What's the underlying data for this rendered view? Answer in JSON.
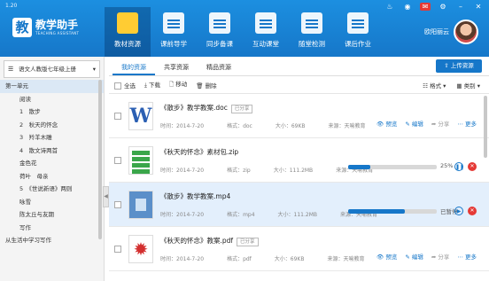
{
  "app": {
    "version": "1.20",
    "title": "教学助手",
    "subtitle": "TEACHING ASSISTANT",
    "user_name": "欧阳丽云"
  },
  "nav": [
    {
      "label": "教材资源",
      "icon": "folder-icon",
      "active": true
    },
    {
      "label": "课前导学",
      "icon": "document-icon",
      "active": false
    },
    {
      "label": "同步备课",
      "icon": "lesson-plan-icon",
      "active": false
    },
    {
      "label": "互动课堂",
      "icon": "classroom-screen-icon",
      "active": false
    },
    {
      "label": "随堂检测",
      "icon": "quiz-icon",
      "active": false
    },
    {
      "label": "课后作业",
      "icon": "homework-icon",
      "active": false
    }
  ],
  "sidebar": {
    "select": "语文人教版七年级上册",
    "items": [
      {
        "label": "第一单元",
        "level": 0
      },
      {
        "label": "阅读",
        "level": 1
      },
      {
        "label": "1　散步",
        "level": 1
      },
      {
        "label": "2　秋天的怀念",
        "level": 1
      },
      {
        "label": "3　羚羊木雕",
        "level": 1
      },
      {
        "label": "4　散文诗两首",
        "level": 1
      },
      {
        "label": "金色花",
        "level": 1
      },
      {
        "label": "荷叶　母亲",
        "level": 1
      },
      {
        "label": "5　《世说新语》两则",
        "level": 1
      },
      {
        "label": "咏雪",
        "level": 1
      },
      {
        "label": "陈太丘与友期",
        "level": 1
      },
      {
        "label": "写作",
        "level": 1
      },
      {
        "label": "从生活中学习写作",
        "level": 0
      }
    ]
  },
  "content": {
    "tabs": [
      {
        "label": "我的资源",
        "active": true
      },
      {
        "label": "共享资源",
        "active": false
      },
      {
        "label": "精品资源",
        "active": false
      }
    ],
    "upload_label": "上传资源",
    "toolbar": {
      "select_all": "全选",
      "download": "下载",
      "move": "移动",
      "delete": "删除",
      "format": "格式",
      "category": "类别"
    },
    "files": [
      {
        "name": "《散步》教学教案.doc",
        "type": "doc",
        "shared": "已分享",
        "time": "时间：2014-7-20",
        "format": "格式：doc",
        "size": "大小：69KB",
        "source": "来源：天喻教育",
        "mode": "actions"
      },
      {
        "name": "《秋天的怀念》素材包.zip",
        "type": "zip",
        "shared": "",
        "time": "时间：2014-7-20",
        "format": "格式：zip",
        "size": "大小：111.2MB",
        "source": "来源：天喻教育",
        "mode": "progress",
        "progress": 25,
        "progress_label": "25%"
      },
      {
        "name": "《散步》教学教案.mp4",
        "type": "mp4",
        "shared": "",
        "time": "时间：2014-7-20",
        "format": "格式：mp4",
        "size": "大小：111.2MB",
        "source": "来源：天喻教育",
        "mode": "progress",
        "progress": 64,
        "progress_label": "已暂停"
      },
      {
        "name": "《秋天的怀念》教案.pdf",
        "type": "pdf",
        "shared": "已分享",
        "time": "时间：2014-7-20",
        "format": "格式：pdf",
        "size": "大小：69KB",
        "source": "来源：天喻教育",
        "mode": "actions"
      }
    ],
    "actions": {
      "preview": "预览",
      "edit": "编辑",
      "share": "分享",
      "more": "更多"
    }
  },
  "colors": {
    "brand": "#1677c9",
    "highlight_row": "#e3effc",
    "zip_green": "#3aa64a",
    "pdf_red": "#d32f2f",
    "cancel_red": "#e53935"
  }
}
